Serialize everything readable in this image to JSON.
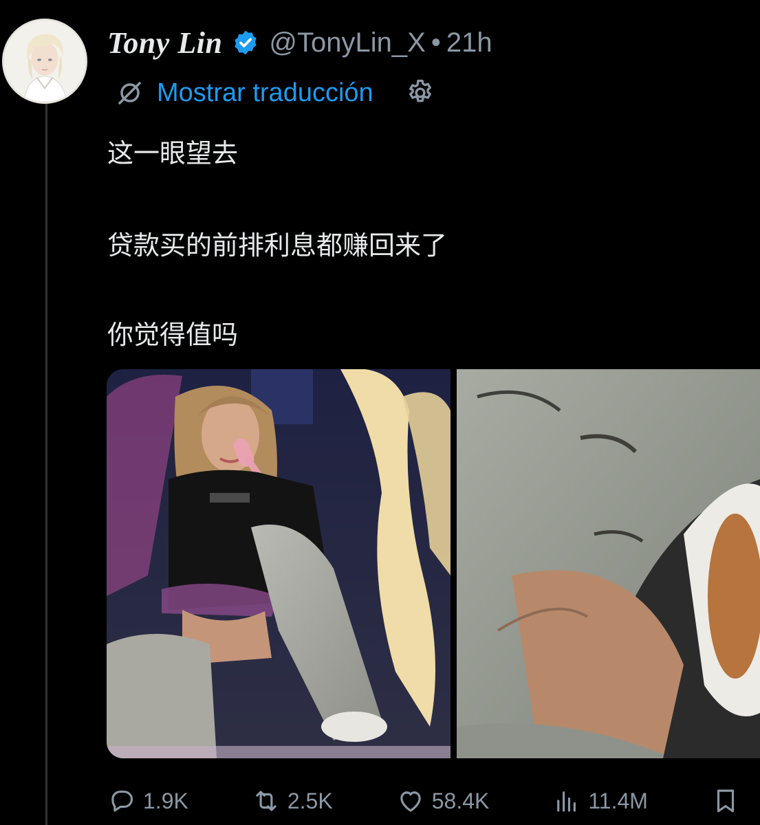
{
  "author": {
    "display_name": "Tony Lin",
    "handle": "@TonyLin_X",
    "separator": "•",
    "time": "21h",
    "verified": true
  },
  "translation": {
    "link_label": "Mostrar traducción",
    "icon": "translate-off-icon",
    "settings_icon": "gear-icon"
  },
  "tweet": {
    "lines": [
      "这一眼望去",
      "贷款买的前排利息都赚回来了",
      "你觉得值吗"
    ]
  },
  "media": {
    "count": 2
  },
  "actions": {
    "replies": "1.9K",
    "reposts": "2.5K",
    "likes": "58.4K",
    "views": "11.4M"
  },
  "colors": {
    "background": "#000000",
    "text": "#e7e9ea",
    "muted": "#8b98a5",
    "link": "#1d9bf0",
    "thread_line": "#2f3336"
  }
}
